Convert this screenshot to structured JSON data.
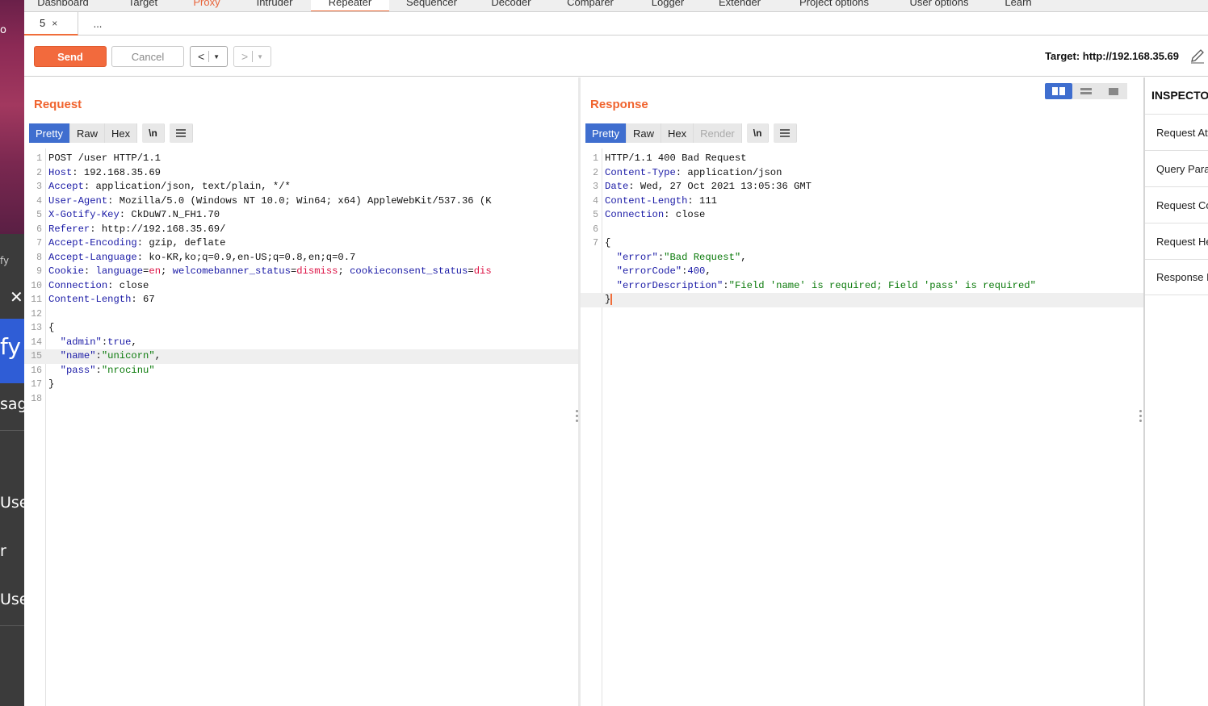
{
  "top_tabs": [
    {
      "label": "Dashboard"
    },
    {
      "label": "Target"
    },
    {
      "label": "Proxy"
    },
    {
      "label": "Intruder"
    },
    {
      "label": "Repeater"
    },
    {
      "label": "Sequencer"
    },
    {
      "label": "Decoder"
    },
    {
      "label": "Comparer"
    },
    {
      "label": "Logger"
    },
    {
      "label": "Extender"
    },
    {
      "label": "Project options"
    },
    {
      "label": "User options"
    },
    {
      "label": "Learn"
    }
  ],
  "sub_tabs": {
    "active_label": "5",
    "close": "×",
    "new_label": "..."
  },
  "toolbar": {
    "send_label": "Send",
    "cancel_label": "Cancel",
    "back_glyph": "<",
    "forward_glyph": ">",
    "dropdown_glyph": "▼",
    "target_text": "Target: http://192.168.35.69"
  },
  "request": {
    "title": "Request",
    "view_tabs": [
      "Pretty",
      "Raw",
      "Hex"
    ],
    "newline_toggle": "\\n",
    "lines": [
      {
        "n": "1",
        "t": "POST /user HTTP/1.1"
      },
      {
        "n": "2",
        "k": "Host",
        "t": ": 192.168.35.69"
      },
      {
        "n": "3",
        "k": "Accept",
        "t": ": application/json, text/plain, */*"
      },
      {
        "n": "4",
        "k": "User-Agent",
        "t": ": Mozilla/5.0 (Windows NT 10.0; Win64; x64) AppleWebKit/537.36 (K"
      },
      {
        "n": "5",
        "k": "X-Gotify-Key",
        "t": ": CkDuW7.N_FH1.70"
      },
      {
        "n": "6",
        "k": "Referer",
        "t": ": http://192.168.35.69/"
      },
      {
        "n": "7",
        "k": "Accept-Encoding",
        "t": ": gzip, deflate"
      },
      {
        "n": "8",
        "k": "Accept-Language",
        "t": ": ko-KR,ko;q=0.9,en-US;q=0.8,en;q=0.7"
      },
      {
        "n": "9",
        "cookie": true,
        "k": "Cookie",
        "c1k": "language",
        "c1v": "en",
        "c2k": "welcomebanner_status",
        "c2v": "dismiss",
        "c3k": "cookieconsent_status",
        "c3v": "dis"
      },
      {
        "n": "10",
        "k": "Connection",
        "t": ": close"
      },
      {
        "n": "11",
        "k": "Content-Length",
        "t": ": 67"
      },
      {
        "n": "12",
        "t": ""
      },
      {
        "n": "13",
        "t": "{"
      },
      {
        "n": "14",
        "json": true,
        "jk": "\"admin\"",
        "jv": "true",
        "num": true,
        "end": ","
      },
      {
        "n": "15",
        "json": true,
        "jk": "\"name\"",
        "jv": "\"unicorn\"",
        "end": ",",
        "hl": true
      },
      {
        "n": "16",
        "json": true,
        "jk": "\"pass\"",
        "jv": "\"nrocinu\"",
        "end": ""
      },
      {
        "n": "17",
        "t": "}"
      },
      {
        "n": "18",
        "t": ""
      }
    ]
  },
  "response": {
    "title": "Response",
    "view_tabs": [
      "Pretty",
      "Raw",
      "Hex",
      "Render"
    ],
    "newline_toggle": "\\n",
    "lines": [
      {
        "n": "1",
        "t": "HTTP/1.1 400 Bad Request"
      },
      {
        "n": "2",
        "k": "Content-Type",
        "t": ": application/json"
      },
      {
        "n": "3",
        "k": "Date",
        "t": ": Wed, 27 Oct 2021 13:05:36 GMT"
      },
      {
        "n": "4",
        "k": "Content-Length",
        "t": ": 111"
      },
      {
        "n": "5",
        "k": "Connection",
        "t": ": close"
      },
      {
        "n": "6",
        "t": ""
      },
      {
        "n": "7",
        "t": "{"
      },
      {
        "n": "",
        "json": true,
        "jk": "\"error\"",
        "jv": "\"Bad Request\"",
        "end": ","
      },
      {
        "n": "",
        "json": true,
        "jk": "\"errorCode\"",
        "jv": "400",
        "num": true,
        "end": ","
      },
      {
        "n": "",
        "json": true,
        "jk": "\"errorDescription\"",
        "jv": "\"Field 'name' is required; Field 'pass' is required\"",
        "end": ""
      },
      {
        "n": "",
        "t": "}",
        "caret": true,
        "hl": true
      }
    ]
  },
  "inspector": {
    "title": "INSPECTOR",
    "items": [
      "Request Attributes",
      "Query Parameters",
      "Request Cookies",
      "Request Headers",
      "Response Headers"
    ]
  },
  "desktop": {
    "texts": [
      "o",
      "fy",
      "fy",
      "sag",
      "Use",
      "r",
      "Use"
    ]
  },
  "colors": {
    "accent": "#f06d3a",
    "active_tab": "#3f6ecf"
  }
}
